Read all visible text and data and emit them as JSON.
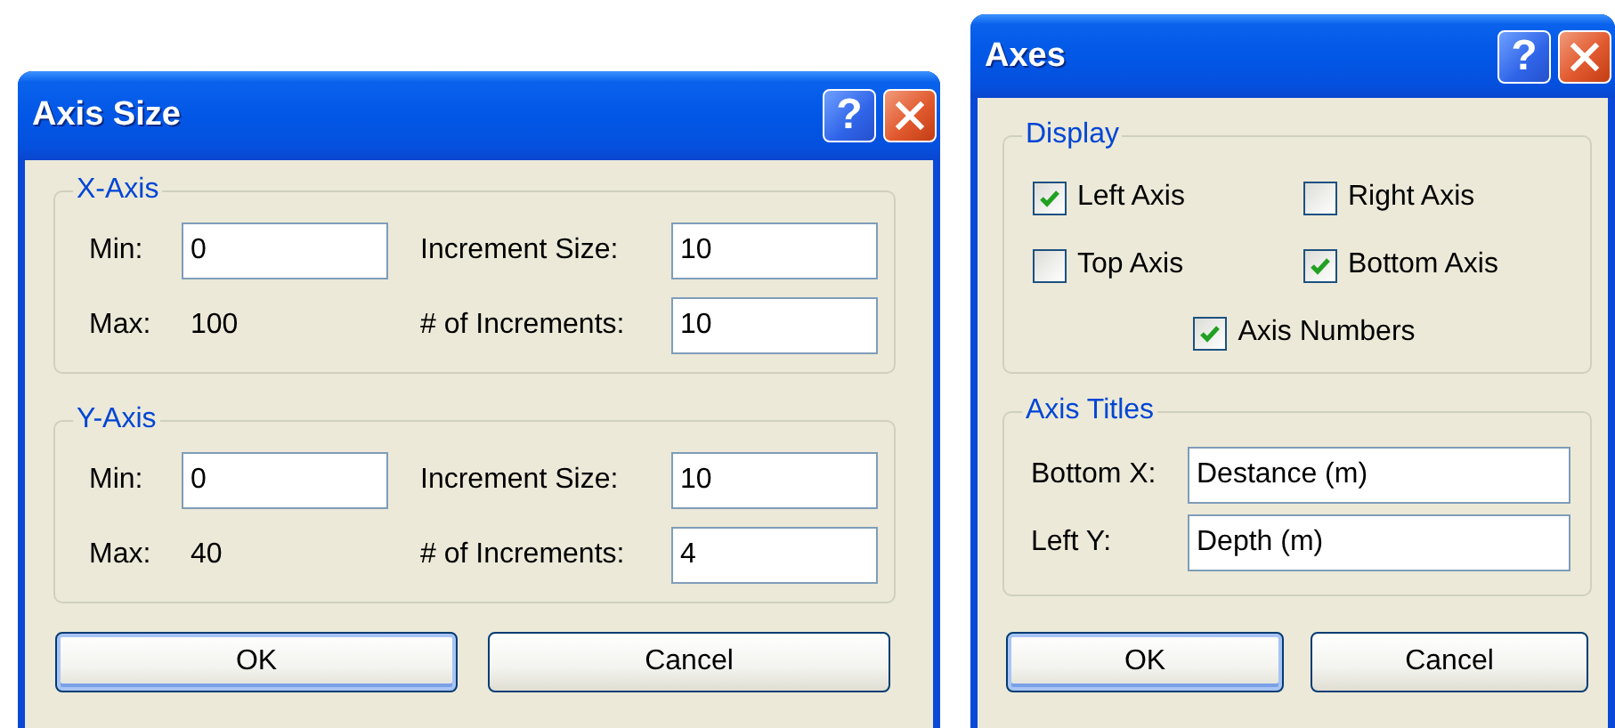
{
  "dialogs": [
    {
      "title": "Axis Size",
      "help_button": "?",
      "groups": [
        {
          "kind": "axis-range",
          "legend": "X-Axis",
          "min_label": "Min:",
          "min_value": "0",
          "max_label": "Max:",
          "max_value": "100",
          "increment_size_label": "Increment Size:",
          "increment_size_value": "10",
          "increments_label": "# of Increments:",
          "increments_value": "10"
        },
        {
          "kind": "axis-range",
          "legend": "Y-Axis",
          "min_label": "Min:",
          "min_value": "0",
          "max_label": "Max:",
          "max_value": "40",
          "increment_size_label": "Increment Size:",
          "increment_size_value": "10",
          "increments_label": "# of Increments:",
          "increments_value": "4"
        }
      ],
      "buttons": [
        {
          "label": "OK",
          "default": true
        },
        {
          "label": "Cancel",
          "default": false
        }
      ]
    },
    {
      "title": "Axes",
      "help_button": "?",
      "groups": [
        {
          "kind": "checkboxes",
          "legend": "Display",
          "checkboxes": [
            {
              "label": "Left Axis",
              "checked": true
            },
            {
              "label": "Right Axis",
              "checked": false
            },
            {
              "label": "Top Axis",
              "checked": false
            },
            {
              "label": "Bottom Axis",
              "checked": true
            },
            {
              "label": "Axis Numbers",
              "checked": true
            }
          ]
        },
        {
          "kind": "text-fields",
          "legend": "Axis Titles",
          "fields": [
            {
              "label": "Bottom X:",
              "value": "Destance (m)"
            },
            {
              "label": "Left Y:",
              "value": "Depth (m)"
            }
          ]
        }
      ],
      "buttons": [
        {
          "label": "OK",
          "default": true
        },
        {
          "label": "Cancel",
          "default": false
        }
      ]
    }
  ]
}
